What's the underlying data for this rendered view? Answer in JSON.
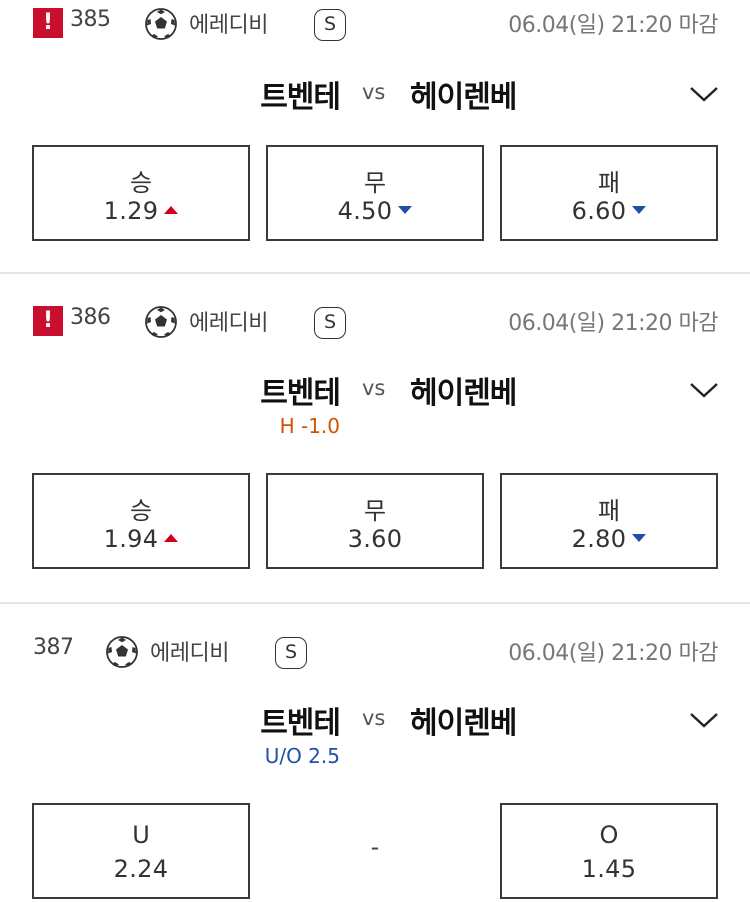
{
  "matches": [
    {
      "number": "385",
      "has_alert": true,
      "alert_mark": "!",
      "league": "에레디비",
      "badge": "S",
      "deadline": "06.04(일) 21:20 마감",
      "home": "트벤테",
      "vs": "vs",
      "away": "헤이렌베",
      "sub": "",
      "odds": [
        {
          "label": "승",
          "value": "1.29",
          "trend": "up"
        },
        {
          "label": "무",
          "value": "4.50",
          "trend": "down"
        },
        {
          "label": "패",
          "value": "6.60",
          "trend": "down"
        }
      ]
    },
    {
      "number": "386",
      "has_alert": true,
      "alert_mark": "!",
      "league": "에레디비",
      "badge": "S",
      "deadline": "06.04(일) 21:20 마감",
      "home": "트벤테",
      "vs": "vs",
      "away": "헤이렌베",
      "sub": "H -1.0",
      "odds": [
        {
          "label": "승",
          "value": "1.94",
          "trend": "up"
        },
        {
          "label": "무",
          "value": "3.60",
          "trend": "none"
        },
        {
          "label": "패",
          "value": "2.80",
          "trend": "down"
        }
      ]
    },
    {
      "number": "387",
      "has_alert": false,
      "league": "에레디비",
      "badge": "S",
      "deadline": "06.04(일) 21:20 마감",
      "home": "트벤테",
      "vs": "vs",
      "away": "헤이렌베",
      "sub": "U/O 2.5",
      "odds": [
        {
          "label": "U",
          "value": "2.24",
          "trend": "none"
        },
        {
          "label": "-",
          "value": "",
          "trend": "none"
        },
        {
          "label": "O",
          "value": "1.45",
          "trend": "none"
        }
      ]
    }
  ],
  "colors": {
    "alert": "#c8102e",
    "trend_up": "#d0021b",
    "trend_down": "#1f4fa8",
    "handicap": "#d35400",
    "under_over": "#2050a8"
  }
}
